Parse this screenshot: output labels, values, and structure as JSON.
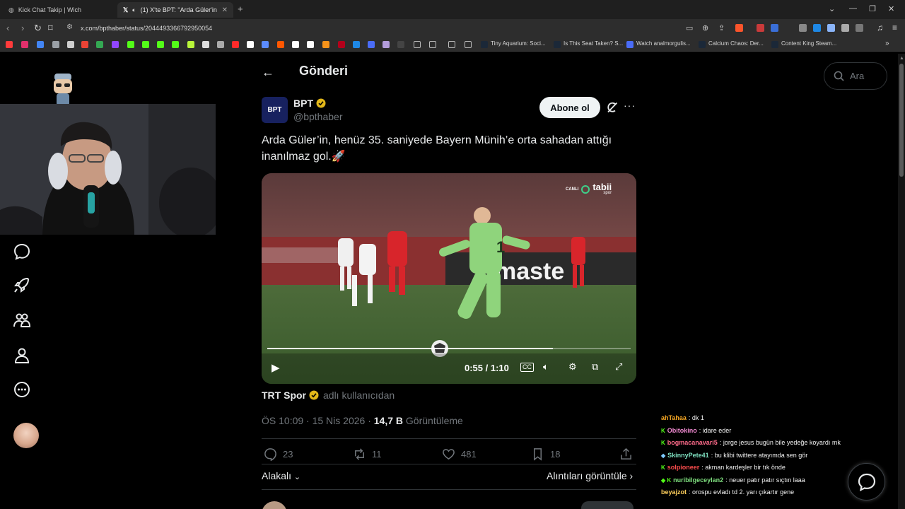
{
  "browser": {
    "tabs": [
      {
        "title": "Kick Chat Takip | Wich"
      },
      {
        "title": "(1) X'te BPT: \"Arda Güler'in, he"
      }
    ],
    "url": "x.com/bpthaber/status/2044493366792950054",
    "bookmarks": [
      "Tiny Aquarium: Soci...",
      "Is This Seat Taken? S...",
      "Watch analmorgulis...",
      "Calcium Chaos: Der...",
      "Content King Steam..."
    ]
  },
  "header": {
    "title": "Gönderi"
  },
  "post": {
    "author_name": "BPT",
    "author_handle": "@bpthaber",
    "avatar_text": "BPT",
    "follow_label": "Abone ol",
    "text": "Arda Güler’in, henüz 35. saniyede Bayern Münih’e orta sahadan attığı inanılmaz gol.🚀",
    "video": {
      "current_time": "0:55",
      "duration": "1:10",
      "time_display": "0:55 / 1:10",
      "progress": 0.786,
      "brand_live": "CANLI",
      "brand_name": "tabii",
      "brand_sub": "spor"
    },
    "source_name": "TRT Spor",
    "source_suffix": "adlı kullanıcıdan",
    "timestamp": "ÖS 10:09 · 15 Nis 2026 · ",
    "views_count": "14,7 B",
    "views_label": " Görüntüleme",
    "stats": {
      "replies": "23",
      "reposts": "11",
      "likes": "481",
      "bookmarks": "18"
    },
    "related_label": "Alakalı",
    "quotes_label": "Alıntıları görüntüle"
  },
  "search": {
    "placeholder": "Ara"
  },
  "chat": [
    {
      "user": "ahTahaa",
      "message": ": dk 1",
      "color": "#f5a623",
      "badge": ""
    },
    {
      "user": "Obitokino",
      "message": ": idare eder",
      "color": "#f08ad1",
      "badge": "K"
    },
    {
      "user": "bogmacanavari5",
      "message": ": jorge jesus bugün bile yedeğe koyardı mk",
      "color": "#ff6b8a",
      "badge": "K"
    },
    {
      "user": "SkinnyPete41",
      "message": ": bu klibi twittere atayımda sen gör",
      "color": "#7ee0c0",
      "badge": "◆"
    },
    {
      "user": "solpioneer",
      "message": ": akman kardeşler bir tık önde",
      "color": "#ff4d4d",
      "badge": "K"
    },
    {
      "user": "nuribilgeceylan2",
      "message": ": neuer patır patır sıçtın laaa",
      "color": "#7fe07f",
      "badge": "◆ K"
    },
    {
      "user": "beyajzot",
      "message": ": orospu evladı td 2. yarı çıkartır gene",
      "color": "#ffcf5c",
      "badge": ""
    }
  ],
  "colors": {
    "accent": "#1d9bf0",
    "verified": "#e2b719",
    "bg": "#000000"
  }
}
